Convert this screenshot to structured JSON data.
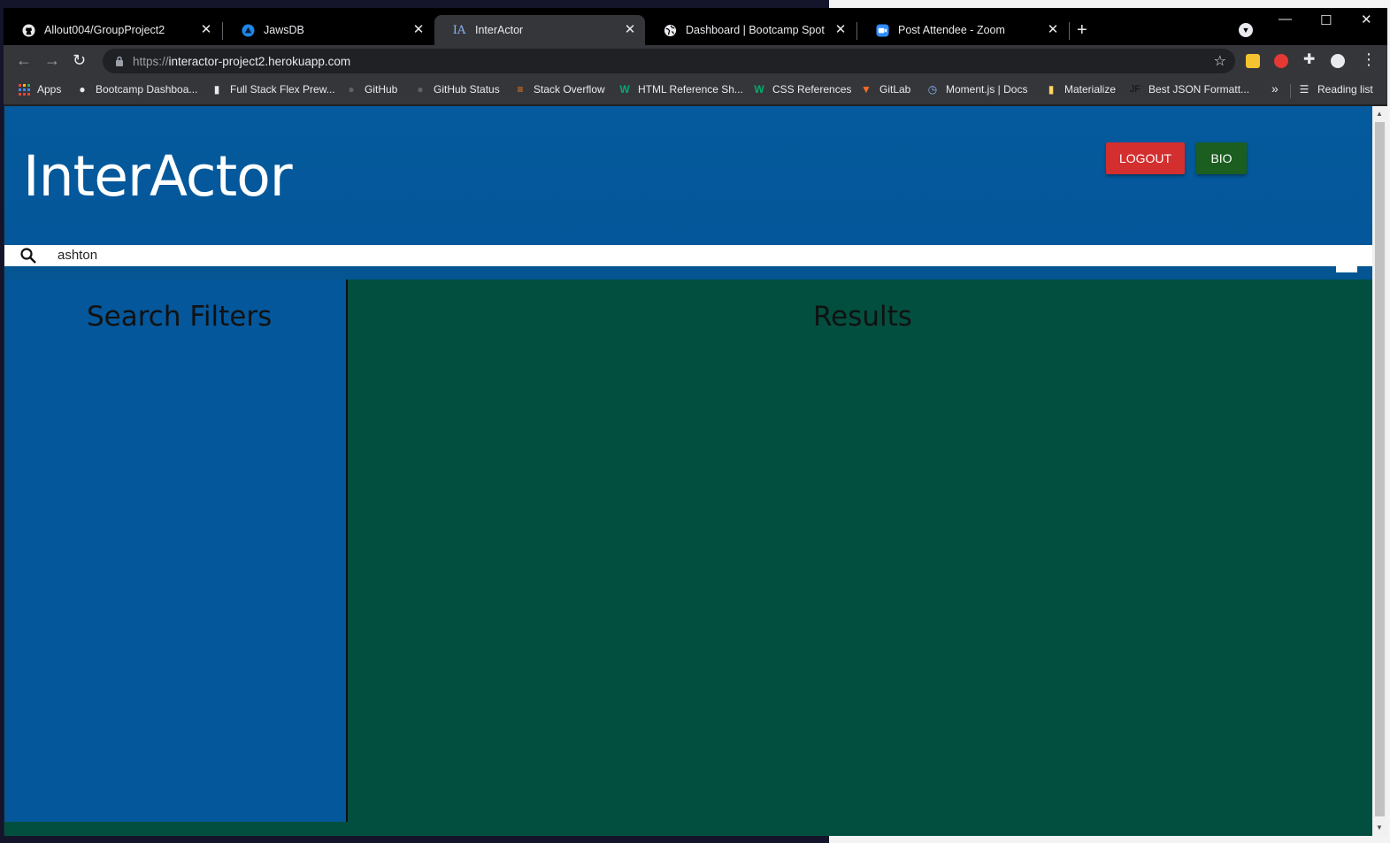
{
  "browser": {
    "tabs": [
      {
        "title": "Allout004/GroupProject2",
        "icon": "github-icon"
      },
      {
        "title": "JawsDB",
        "icon": "jawsdb-icon"
      },
      {
        "title": "InterActor",
        "icon": "interactor-icon",
        "active": true
      },
      {
        "title": "Dashboard | Bootcamp Spot",
        "icon": "globe-icon"
      },
      {
        "title": "Post Attendee - Zoom",
        "icon": "zoom-icon"
      }
    ],
    "new_tab_label": "+",
    "url_scheme": "https://",
    "url_host": "interactor-project2.herokuapp.com",
    "bookmarks": [
      {
        "label": "Apps",
        "icon": "apps-grid-icon"
      },
      {
        "label": "Bootcamp Dashboa...",
        "icon": "globe-icon"
      },
      {
        "label": "Full Stack Flex Prew...",
        "icon": "book-icon"
      },
      {
        "label": "GitHub",
        "icon": "github-icon"
      },
      {
        "label": "GitHub Status",
        "icon": "github-icon"
      },
      {
        "label": "Stack Overflow",
        "icon": "stackoverflow-icon"
      },
      {
        "label": "HTML Reference Sh...",
        "icon": "w-icon"
      },
      {
        "label": "CSS References",
        "icon": "w-icon"
      },
      {
        "label": "GitLab",
        "icon": "gitlab-icon"
      },
      {
        "label": "Moment.js | Docs",
        "icon": "clock-icon"
      },
      {
        "label": "Materialize",
        "icon": "folder-icon"
      },
      {
        "label": "Best JSON Formatt...",
        "icon": "jf-icon"
      }
    ],
    "more_bookmarks": "»",
    "reading_list": "Reading list"
  },
  "page": {
    "brand": "InterActor",
    "logout_label": "LOGOUT",
    "bio_label": "BIO",
    "search_value": "ashton",
    "filters_title": "Search Filters",
    "results_title": "Results"
  },
  "colors": {
    "header_blue": "#04579a",
    "results_green": "#024f3f",
    "logout_red": "#d32f2f",
    "bio_green": "#1b5e20"
  }
}
